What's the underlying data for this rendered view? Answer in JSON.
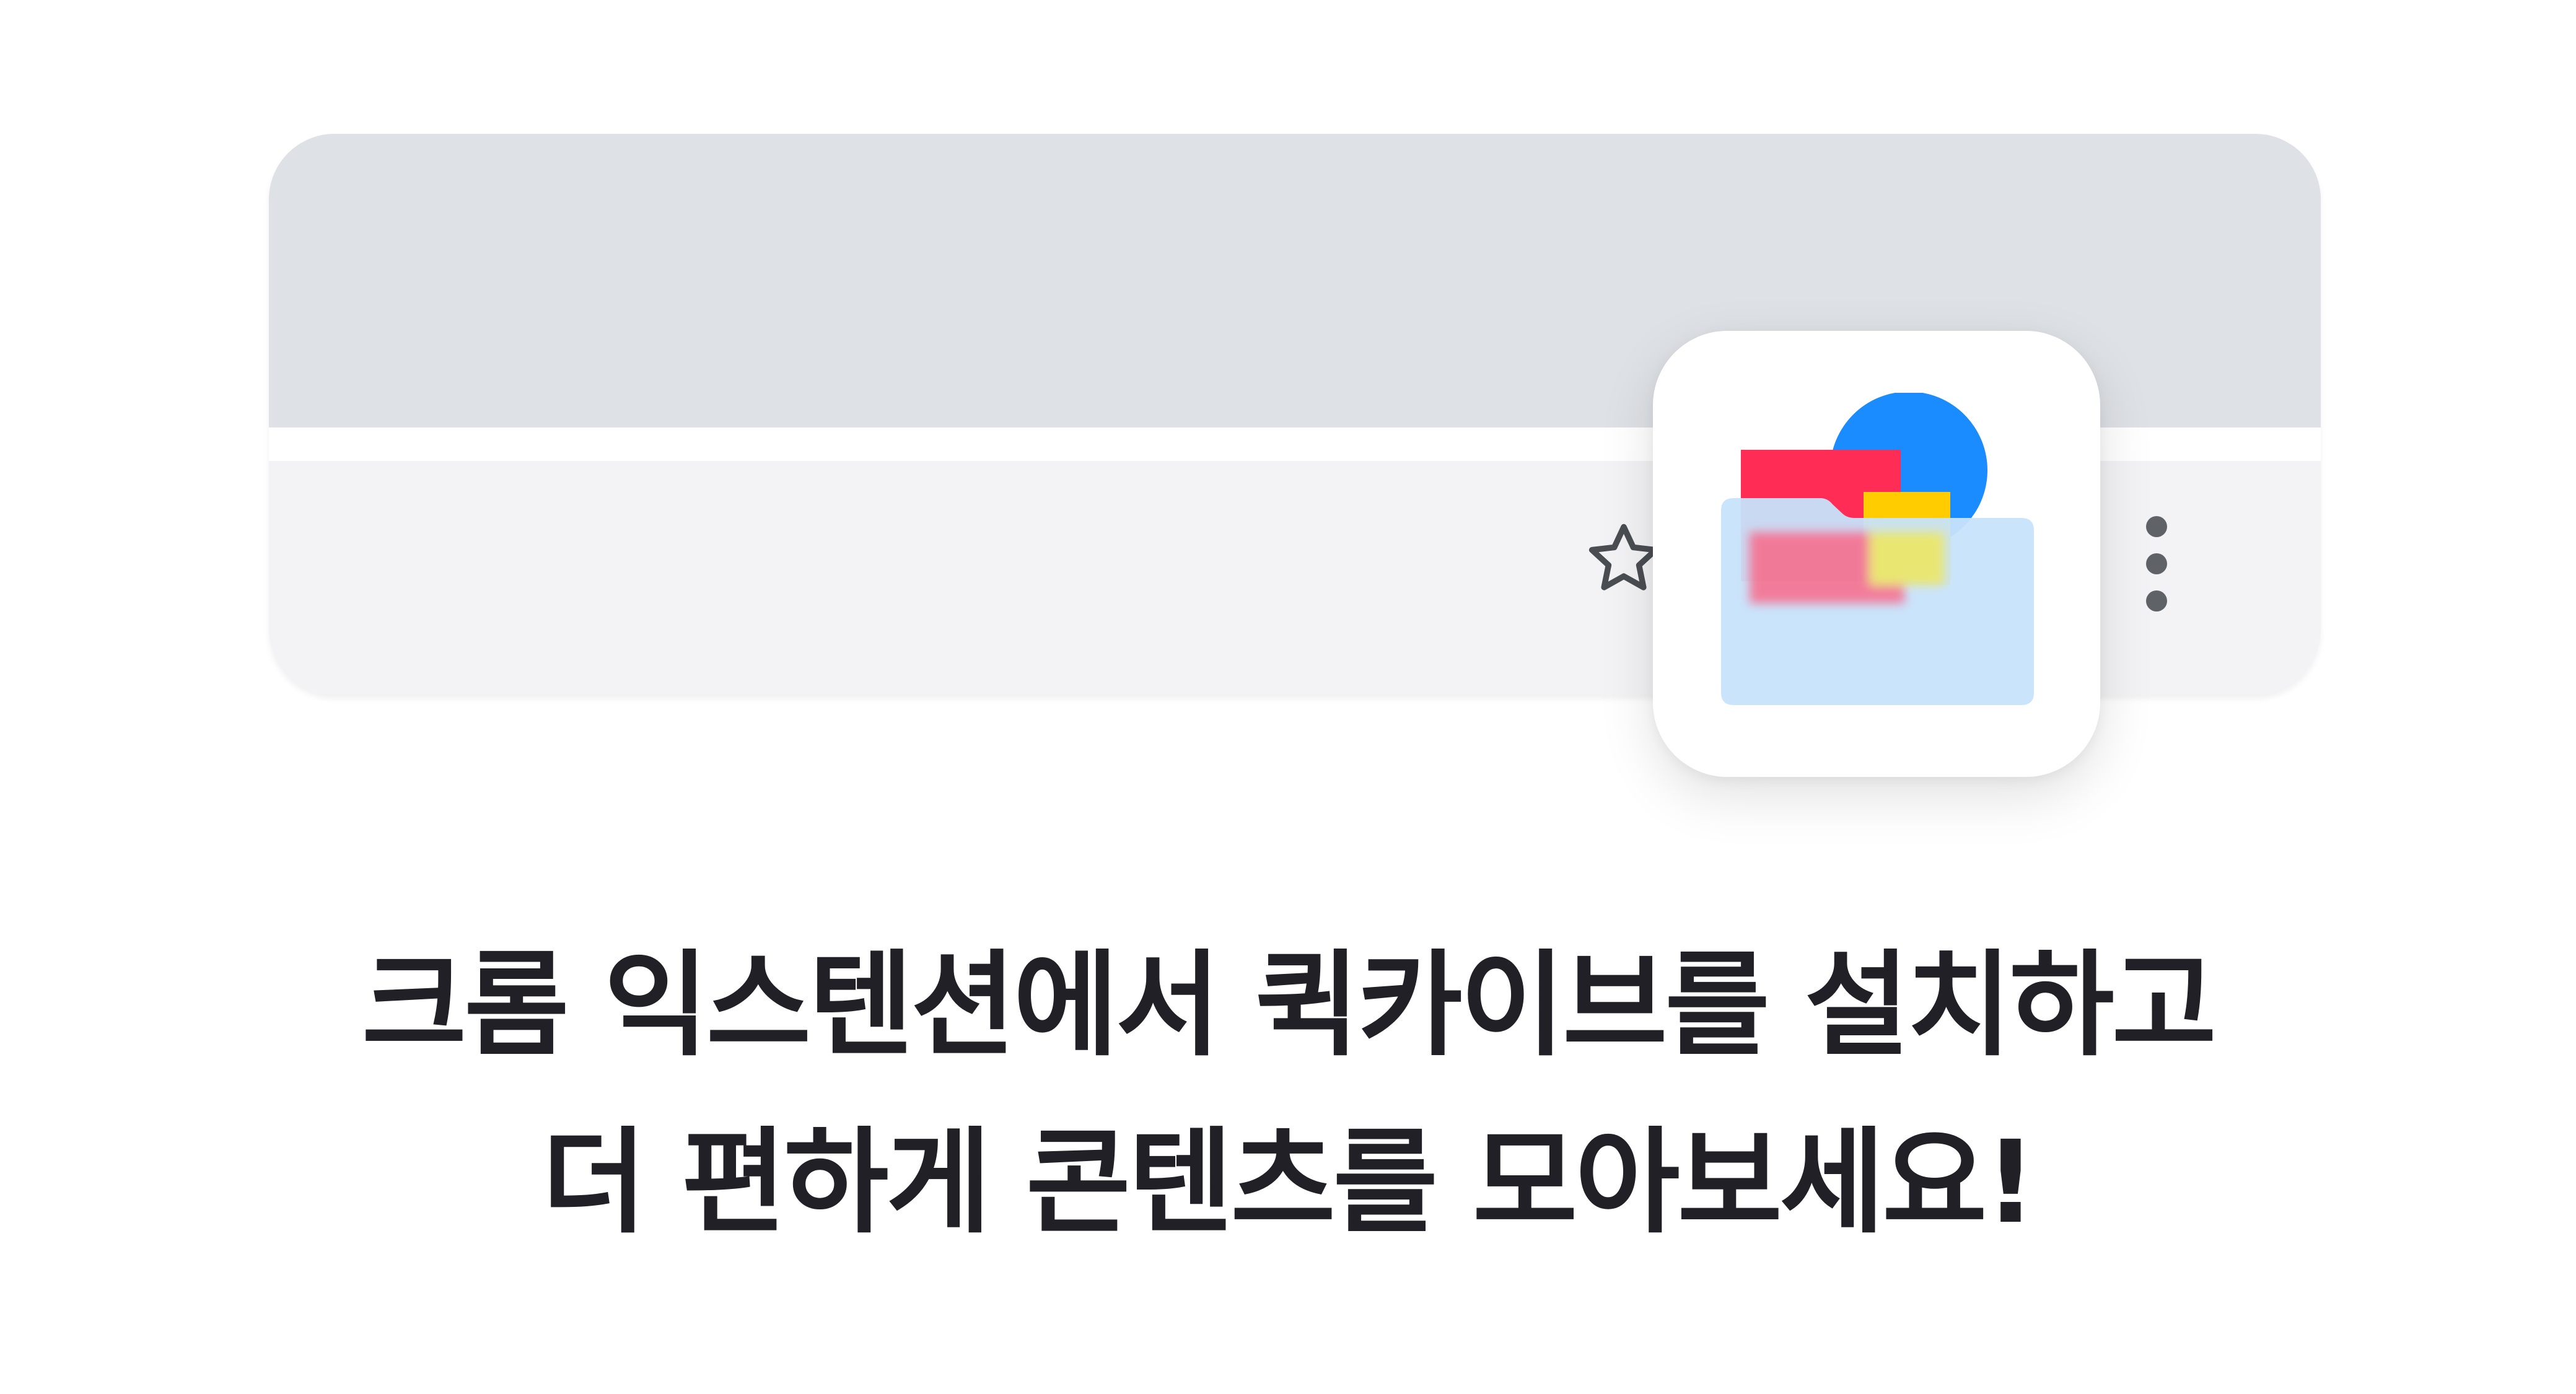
{
  "headline": {
    "line1": "크롬 익스텐션에서 퀵카이브를 설치하고",
    "line2": "더 편하게 콘텐츠를 모아보세요!"
  },
  "icons": {
    "bookmark": "star-icon",
    "menu": "more-vertical-icon",
    "extension": "quickive-logo-icon"
  },
  "colors": {
    "tab_strip": "#dee1e5",
    "toolbar": "#f3f3f5",
    "text": "#202026",
    "logo_blue": "#1a8cff",
    "logo_red": "#ff2d55",
    "logo_yellow": "#ffcc00",
    "logo_folder": "#c7e3fb"
  }
}
